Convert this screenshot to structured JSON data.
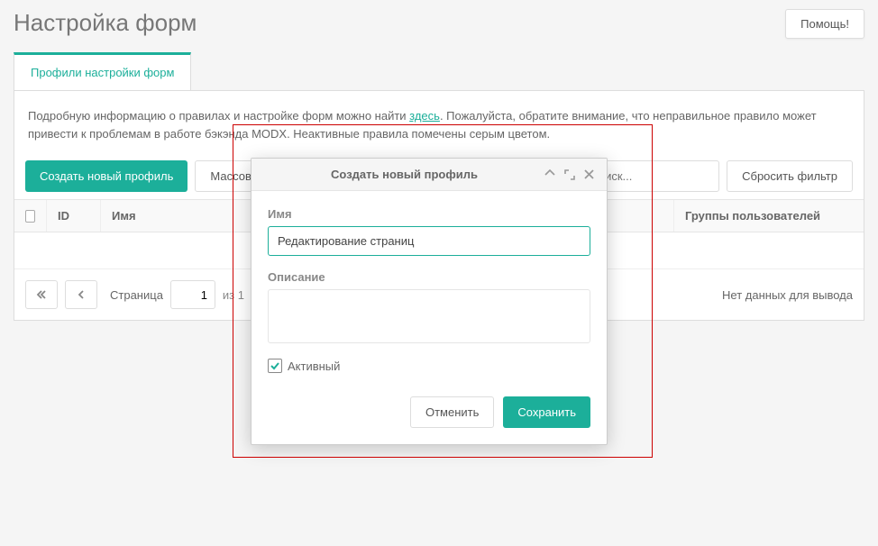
{
  "header": {
    "title": "Настройка форм",
    "help_label": "Помощь!"
  },
  "tabs": {
    "active_label": "Профили настройки форм"
  },
  "info": {
    "before": "Подробную информацию о правилах и настройке форм можно найти ",
    "link": "здесь",
    "after": ". Пожалуйста, обратите внимание, что неправильное правило может привести к проблемам в работе бэкэнда MODX. Неактивные правила помечены серым цветом."
  },
  "toolbar": {
    "create_label": "Создать новый профиль",
    "bulk_prefix": "Массовь",
    "search_placeholder": "иск...",
    "reset_filter": "Сбросить фильтр"
  },
  "columns": {
    "id": "ID",
    "name": "Имя",
    "groups": "Группы пользователей"
  },
  "pager": {
    "page_label": "Страница",
    "current": "1",
    "of": "из 1",
    "empty": "Нет данных для вывода"
  },
  "modal": {
    "title": "Создать новый профиль",
    "name_label": "Имя",
    "name_value": "Редактирование страниц",
    "desc_label": "Описание",
    "active_label": "Активный",
    "cancel": "Отменить",
    "save": "Сохранить"
  }
}
